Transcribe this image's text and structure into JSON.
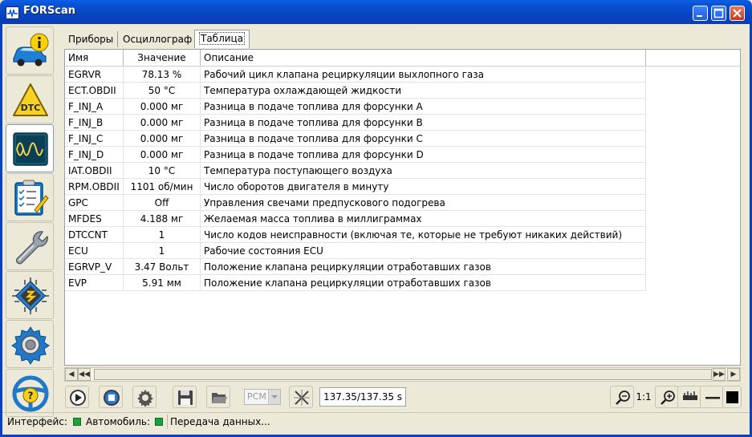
{
  "window": {
    "title": "FORScan"
  },
  "tabs": [
    {
      "label": "Приборы"
    },
    {
      "label": "Осциллограф"
    },
    {
      "label": "Таблица"
    }
  ],
  "table": {
    "columns": [
      "Имя",
      "Значение",
      "Описание"
    ],
    "rows": [
      {
        "name": "EGRVR",
        "value": "78.13 %",
        "description": "Рабочий цикл клапана рециркуляции выхлопного газа"
      },
      {
        "name": "ECT.OBDII",
        "value": "50 °C",
        "description": "Температура охлаждающей жидкости"
      },
      {
        "name": "F_INJ_A",
        "value": "0.000 мг",
        "description": "Разница в подаче топлива для форсунки A"
      },
      {
        "name": "F_INJ_B",
        "value": "0.000 мг",
        "description": "Разница в подаче топлива для форсунки B"
      },
      {
        "name": "F_INJ_C",
        "value": "0.000 мг",
        "description": "Разница в подаче топлива для форсунки C"
      },
      {
        "name": "F_INJ_D",
        "value": "0.000 мг",
        "description": "Разница в подаче топлива для форсунки D"
      },
      {
        "name": "IAT.OBDII",
        "value": "10 °C",
        "description": "Температура поступающего воздуха"
      },
      {
        "name": "RPM.OBDII",
        "value": "1101 об/мин",
        "description": "Число оборотов двигателя в минуту"
      },
      {
        "name": "GPC",
        "value": "Off",
        "description": "Управления свечами предпускового подогрева"
      },
      {
        "name": "MFDES",
        "value": "4.188 мг",
        "description": "Желаемая масса топлива в миллиграммах"
      },
      {
        "name": "DTCCNT",
        "value": "1",
        "description": "Число кодов неисправности (включая те, которые не требуют никаких действий)"
      },
      {
        "name": "ECU",
        "value": "1",
        "description": "Рабочие состояния ECU"
      },
      {
        "name": "EGRVP_V",
        "value": "3.47 Вольт",
        "description": "Положение клапана рециркуляции отработавших газов"
      },
      {
        "name": "EVP",
        "value": "5.91 мм",
        "description": "Положение клапана рециркуляции отработавших газов"
      }
    ]
  },
  "sidebar": {
    "items": [
      {
        "icon": "car-info-icon"
      },
      {
        "icon": "dtc-warning-icon"
      },
      {
        "icon": "oscilloscope-icon"
      },
      {
        "icon": "checklist-icon"
      },
      {
        "icon": "wrench-icon"
      },
      {
        "icon": "chip-icon"
      },
      {
        "icon": "settings-gear-icon"
      },
      {
        "icon": "steering-help-icon"
      }
    ]
  },
  "toolbar": {
    "module_select": "PCM",
    "time": "137.35/137.35 s",
    "zoom_label": "1:1"
  },
  "statusbar": {
    "interface_label": "Интерфейс:",
    "vehicle_label": "Автомобиль:",
    "transfer_text": "Передача данных..."
  },
  "colors": {
    "titlebar": "#0A5FE6",
    "status_led": "#1AA13A",
    "frame": "#0842C0"
  }
}
